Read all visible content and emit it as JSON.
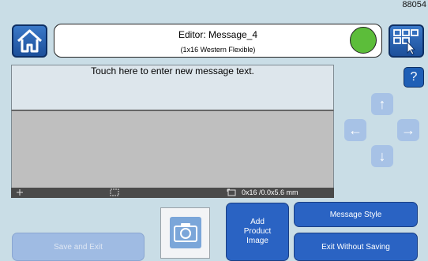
{
  "corner_id": "88054",
  "header": {
    "title": "Editor: Message_4",
    "subtitle": "(1x16 Western Flexible)"
  },
  "editor": {
    "hint": "Touch here to enter new message text."
  },
  "status_bar": {
    "dimension": "0x16 /0.0x5.6 mm"
  },
  "nav": {
    "help": "?",
    "up": "↑",
    "left": "←",
    "right": "→",
    "down": "↓"
  },
  "buttons": {
    "save_exit": "Save and Exit",
    "add_image": "Add Product Image",
    "message_style": "Message Style",
    "exit_no_save": "Exit Without Saving"
  },
  "colors": {
    "status": "#5cbd3a",
    "accent": "#2a63c3",
    "background": "#c9dde6"
  },
  "icons": [
    "home-icon",
    "keypad-pointer-icon",
    "move-icon",
    "select-region-icon",
    "size-icon",
    "camera-icon"
  ]
}
